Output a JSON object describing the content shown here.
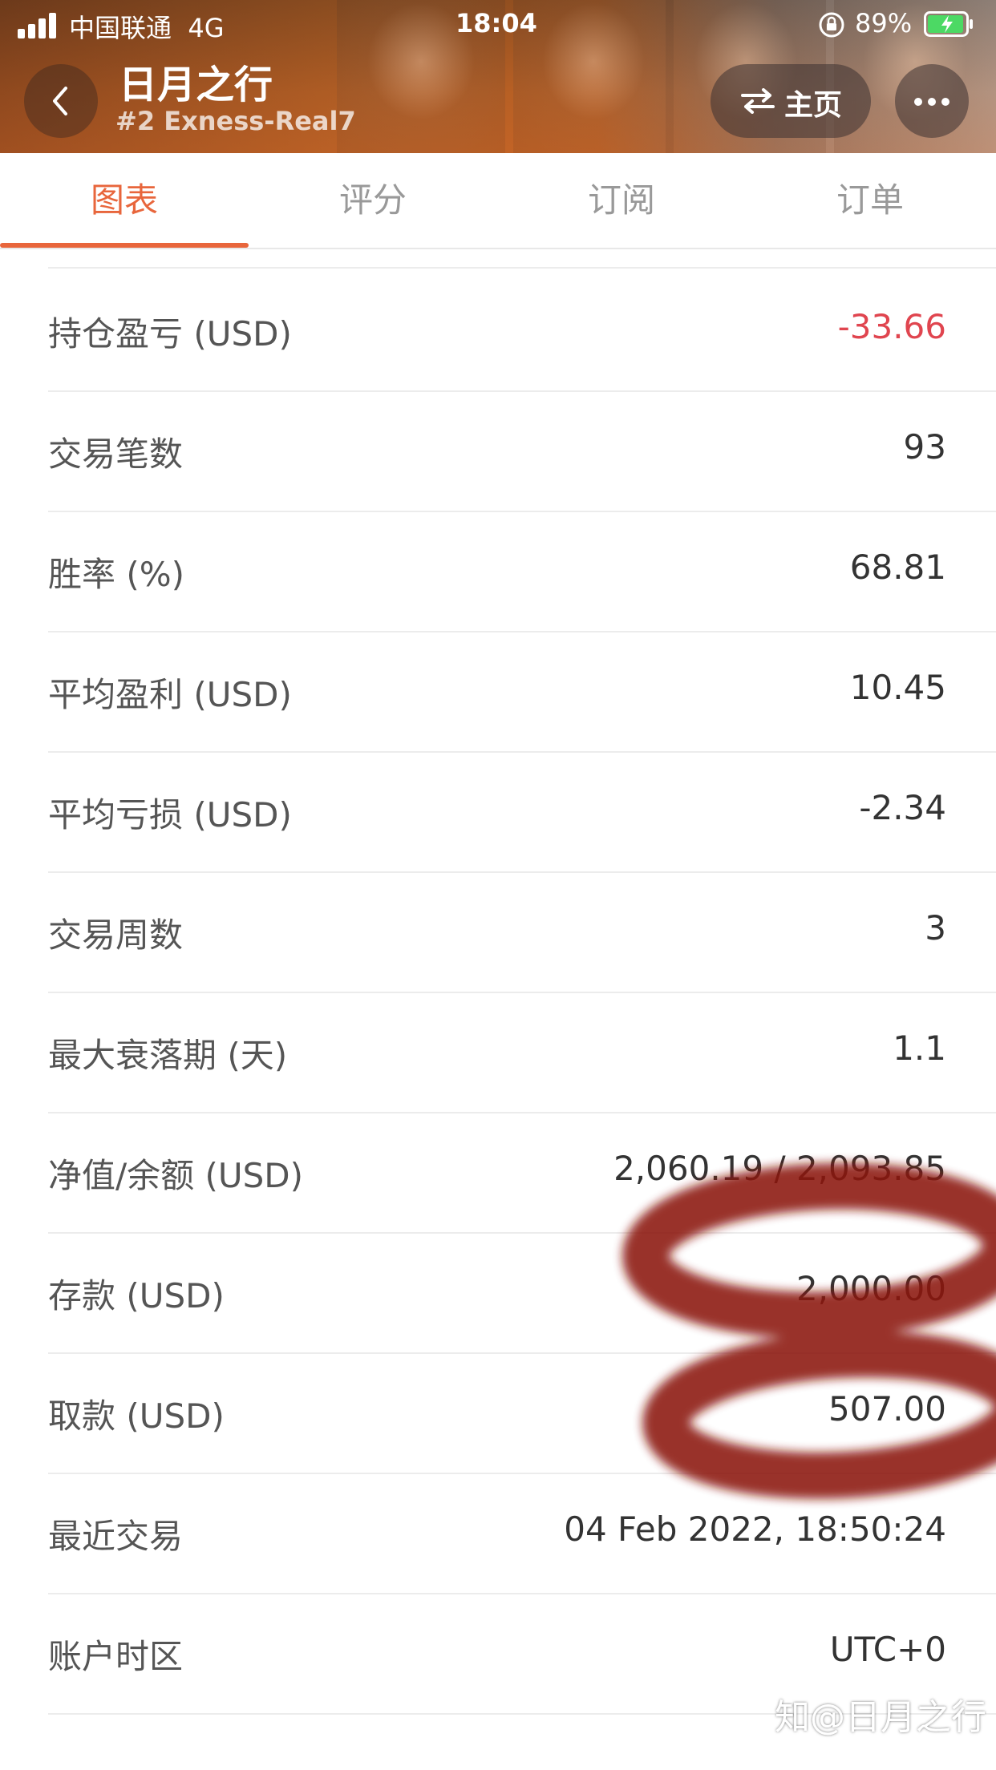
{
  "status_bar": {
    "carrier": "中国联通",
    "network": "4G",
    "time": "18:04",
    "battery": "89%"
  },
  "header": {
    "title": "日月之行",
    "subtitle": "#2 Exness-Real7",
    "home_label": "主页",
    "back_icon": "chevron-left-icon",
    "more_icon": "more-dots-icon",
    "swap_icon": "swap-arrows-icon"
  },
  "tabs": [
    {
      "label": "图表",
      "active": true
    },
    {
      "label": "评分",
      "active": false
    },
    {
      "label": "订阅",
      "active": false
    },
    {
      "label": "订单",
      "active": false
    }
  ],
  "stats": [
    {
      "label": "持仓盈亏 (USD)",
      "value": "-33.66",
      "negative": true
    },
    {
      "label": "交易笔数",
      "value": "93"
    },
    {
      "label": "胜率 (%)",
      "value": "68.81"
    },
    {
      "label": "平均盈利 (USD)",
      "value": "10.45"
    },
    {
      "label": "平均亏损 (USD)",
      "value": "-2.34"
    },
    {
      "label": "交易周数",
      "value": "3"
    },
    {
      "label": "最大衰落期 (天)",
      "value": "1.1"
    },
    {
      "label": "净值/余额 (USD)",
      "value": "2,060.19 / 2,093.85"
    },
    {
      "label": "存款 (USD)",
      "value": "2,000.00"
    },
    {
      "label": "取款 (USD)",
      "value": "507.00"
    },
    {
      "label": "最近交易",
      "value": "04 Feb 2022, 18:50:24"
    },
    {
      "label": "账户时区",
      "value": "UTC+0"
    }
  ],
  "watermark": "知@日月之行",
  "colors": {
    "accent": "#e8663c",
    "negative": "#e0454f",
    "scribble": "#8b1208"
  }
}
